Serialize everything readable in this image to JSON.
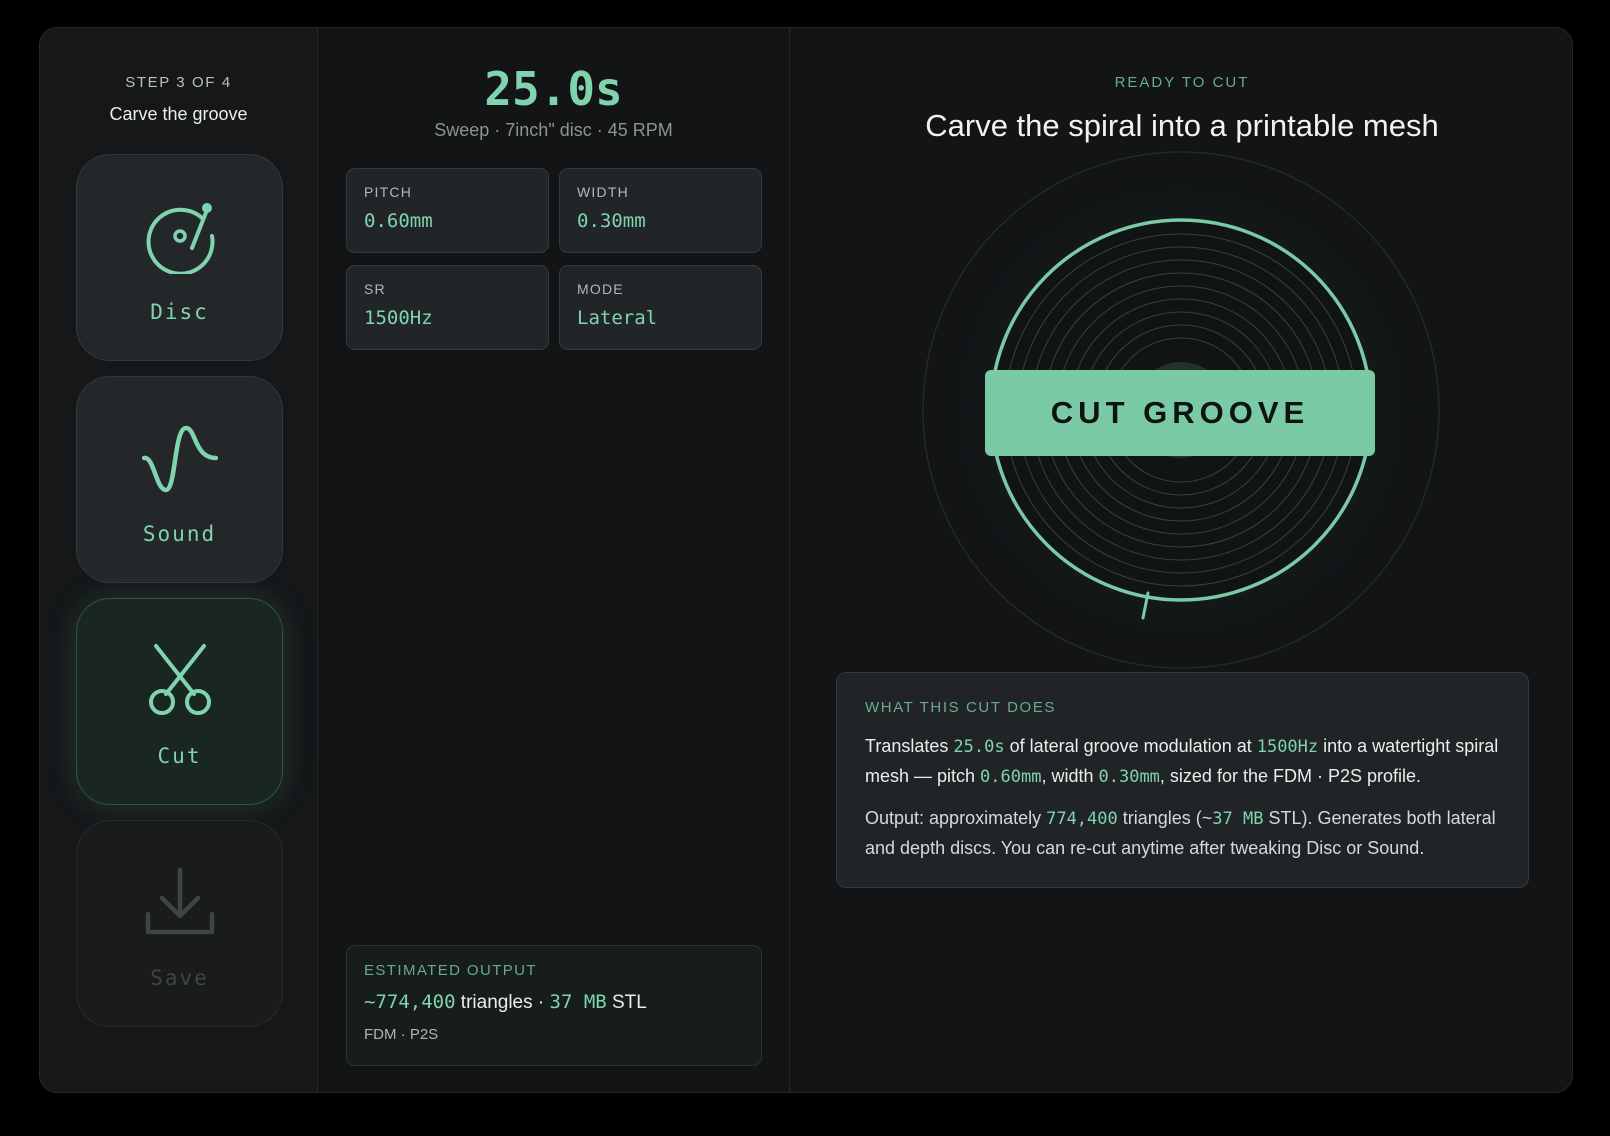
{
  "sidebar": {
    "step_label": "STEP 3 OF 4",
    "step_title": "Carve the groove",
    "steps": [
      {
        "label": "Disc",
        "icon": "disc-icon",
        "state": "done"
      },
      {
        "label": "Sound",
        "icon": "waveform-icon",
        "state": "done"
      },
      {
        "label": "Cut",
        "icon": "scissors-icon",
        "state": "active"
      },
      {
        "label": "Save",
        "icon": "download-icon",
        "state": "disabled"
      }
    ]
  },
  "summary": {
    "duration": "25.0s",
    "meta": "Sweep · 7inch\" disc · 45 RPM",
    "params": [
      {
        "label": "PITCH",
        "value": "0.60mm"
      },
      {
        "label": "WIDTH",
        "value": "0.30mm"
      },
      {
        "label": "SR",
        "value": "1500Hz"
      },
      {
        "label": "MODE",
        "value": "Lateral"
      }
    ],
    "estimate": {
      "label": "ESTIMATED OUTPUT",
      "triangles": "~774,400",
      "triangles_unit": " triangles · ",
      "size": "37 MB",
      "size_unit": " STL",
      "profile": "FDM · P2S"
    }
  },
  "cut": {
    "status": "READY TO CUT",
    "headline": "Carve the spiral into a printable mesh",
    "button_label": "CUT GROOVE",
    "info": {
      "label": "WHAT THIS CUT DOES",
      "p1": {
        "t1": "Translates ",
        "v1": "25.0s",
        "t2": " of lateral groove modulation at ",
        "v2": "1500Hz",
        "t3": " into a watertight spiral mesh — pitch ",
        "v3": "0.60mm",
        "t4": ", width ",
        "v4": "0.30mm",
        "t5": ", sized for the FDM · P2S profile."
      },
      "p2": {
        "t1": "Output: approximately ",
        "v1": "774,400",
        "t2": " triangles (~",
        "v2": "37 MB",
        "t3": " STL). Generates both lateral and depth discs. You can re-cut anytime after tweaking Disc or Sound."
      }
    }
  },
  "colors": {
    "accent": "#7fd3ad",
    "accent_button": "#7acaa6",
    "background": "#121416",
    "panel": "#222528"
  }
}
